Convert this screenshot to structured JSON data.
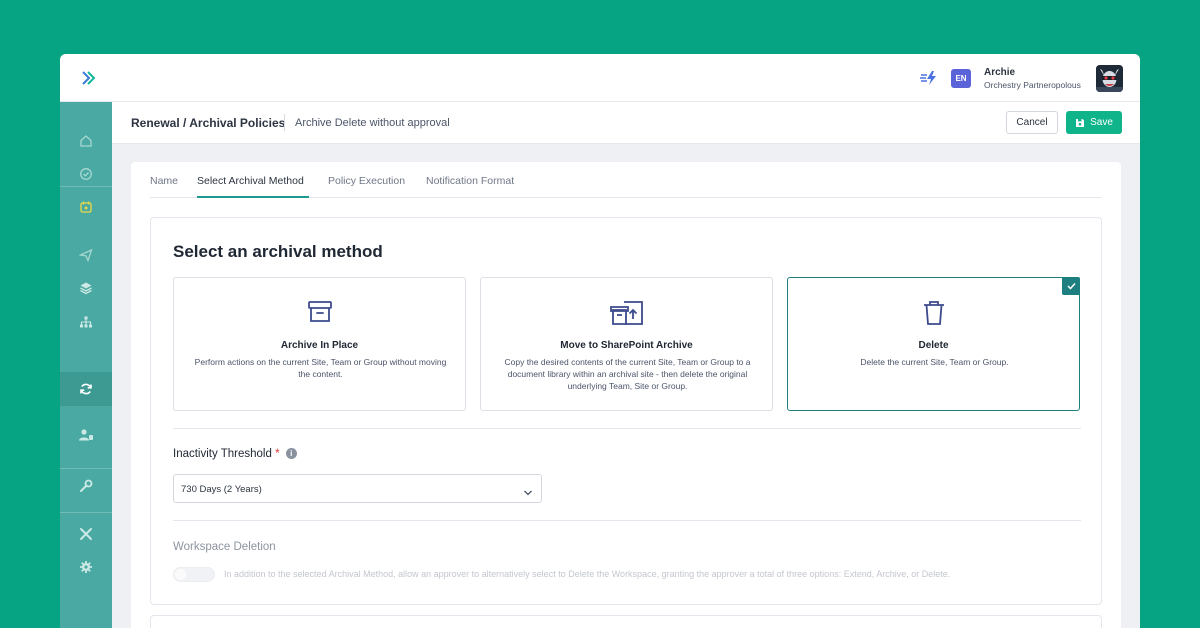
{
  "app": {
    "user": {
      "name": "Archie",
      "org": "Orchestry Partneropolous"
    },
    "language": "EN"
  },
  "sidebar": {
    "items": [
      {
        "icon": "home-icon"
      },
      {
        "icon": "check-circle-icon"
      },
      {
        "icon": "calendar-icon"
      },
      {
        "icon": "send-icon"
      },
      {
        "icon": "layers-icon"
      },
      {
        "icon": "hierarchy-icon"
      },
      {
        "icon": "refresh-icon",
        "active": true
      },
      {
        "icon": "users-icon"
      },
      {
        "icon": "wrench-icon"
      },
      {
        "icon": "tools-icon"
      },
      {
        "icon": "gear-icon"
      }
    ]
  },
  "header": {
    "breadcrumb": "Renewal / Archival Policies",
    "subtitle": "Archive Delete without approval",
    "cancel_label": "Cancel",
    "save_label": "Save"
  },
  "tabs": [
    {
      "label": "Name"
    },
    {
      "label": "Select Archival Method",
      "active": true
    },
    {
      "label": "Policy Execution"
    },
    {
      "label": "Notification Format"
    }
  ],
  "main": {
    "title": "Select an archival method",
    "options": [
      {
        "title": "Archive In Place",
        "description": "Perform actions on the current Site, Team or Group without moving the content.",
        "icon": "archive-box-icon",
        "selected": false
      },
      {
        "title": "Move to SharePoint Archive",
        "description": "Copy the desired contents of the current Site, Team or Group to a document library within an archival site - then delete the original underlying Team, Site or Group.",
        "icon": "move-archive-icon",
        "selected": false
      },
      {
        "title": "Delete",
        "description": "Delete the current Site, Team or Group.",
        "icon": "trash-icon",
        "selected": true
      }
    ],
    "inactivity": {
      "label": "Inactivity Threshold",
      "required_mark": "*",
      "value": "730 Days (2 Years)"
    },
    "workspace_deletion": {
      "label": "Workspace Deletion",
      "enabled": false,
      "description": "In addition to the selected Archival Method, allow an approver to alternatively select to Delete the Workspace, granting the approver a total of three options: Extend, Archive, or Delete."
    }
  },
  "colors": {
    "background": "#06a483",
    "sidebar": "#4aa9a2",
    "accent": "#1d7f80",
    "save_button": "#10b48a",
    "language_badge": "#5b63d8"
  }
}
